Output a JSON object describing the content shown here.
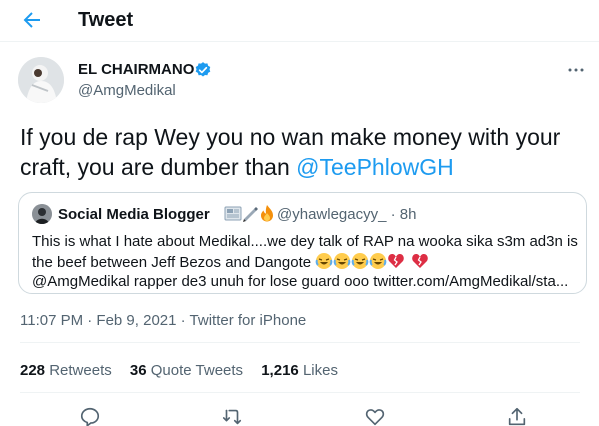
{
  "header": {
    "title": "Tweet"
  },
  "author": {
    "name": "EL CHAIRMANO",
    "handle": "@AmgMedikal"
  },
  "tweet": {
    "text_before": "If you de rap Wey you no wan make money with your craft, you are dumber than ",
    "mention": "@TeePhlowGH"
  },
  "quote": {
    "name": "Social Media Blogger",
    "handle": "@yhawlegacyy_ · 8h",
    "line1": "This is what I hate about Medikal....we dey talk of RAP na wooka sika s3m ad3n is",
    "line2": "the beef between Jeff Bezos and Dangote",
    "line3": "@AmgMedikal rapper de3 unuh for lose guard ooo twitter.com/AmgMedikal/sta..."
  },
  "meta": {
    "time": "11:07 PM · Feb 9, 2021 · Twitter for iPhone"
  },
  "stats": {
    "retweets_count": "228",
    "retweets_label": "Retweets",
    "quotes_count": "36",
    "quotes_label": "Quote Tweets",
    "likes_count": "1,216",
    "likes_label": "Likes"
  },
  "colors": {
    "accent": "#1d9bf0",
    "text": "#0f1419",
    "muted": "#536471",
    "border": "#cfd9de"
  },
  "icons": [
    "back-arrow-icon",
    "verified-badge-icon",
    "more-options-icon",
    "reply-icon",
    "retweet-icon",
    "like-icon",
    "share-icon"
  ]
}
